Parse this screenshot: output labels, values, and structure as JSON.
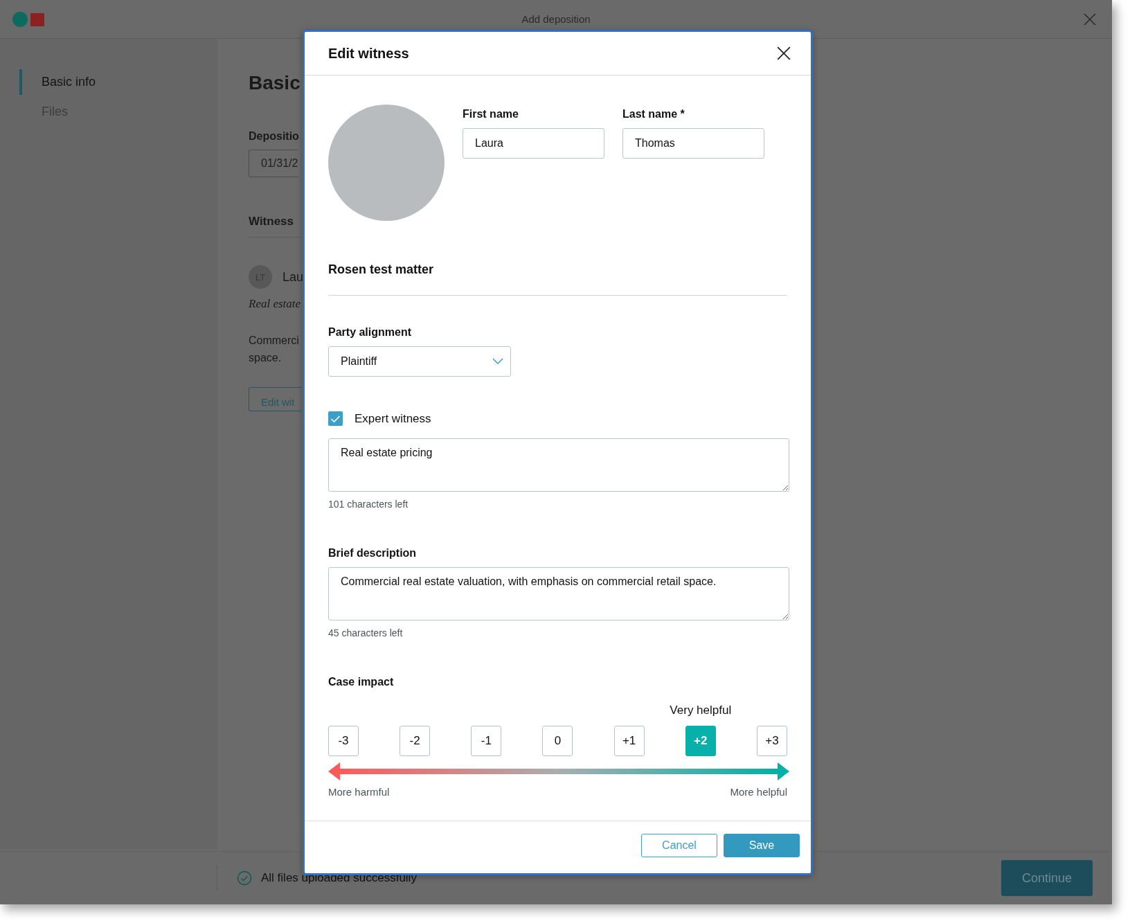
{
  "window": {
    "title": "Add deposition"
  },
  "sidebar": {
    "items": [
      {
        "label": "Basic info",
        "selected": true
      },
      {
        "label": "Files",
        "selected": false
      }
    ]
  },
  "background": {
    "heading": "Basic",
    "date_label": "Depositio",
    "date_value": "01/31/2",
    "witness_heading": "Witness",
    "witness_initials": "LT",
    "witness_name": "Lau",
    "witness_expertise": "Real estate",
    "witness_description": [
      "Commerci",
      "space."
    ],
    "edit_button": "Edit wit"
  },
  "footer": {
    "status": "All files uploaded successfully",
    "continue_button": "Continue"
  },
  "modal": {
    "title": "Edit witness",
    "first_name": {
      "label": "First name",
      "value": "Laura"
    },
    "last_name": {
      "label": "Last name *",
      "value": "Thomas"
    },
    "matter": "Rosen test matter",
    "party_alignment": {
      "label": "Party alignment",
      "value": "Plaintiff"
    },
    "expert_witness": {
      "label": "Expert witness",
      "checked": true,
      "value": "Real estate pricing",
      "counter": "101 characters left"
    },
    "brief_description": {
      "label": "Brief description",
      "value": "Commercial real estate valuation, with emphasis on commercial retail space.",
      "counter": "45 characters left"
    },
    "case_impact": {
      "label": "Case impact",
      "options": [
        {
          "label": "-3",
          "selected": false
        },
        {
          "label": "-2",
          "selected": false
        },
        {
          "label": "-1",
          "selected": false
        },
        {
          "label": "0",
          "selected": false
        },
        {
          "label": "+1",
          "selected": false
        },
        {
          "label": "+2",
          "selected": true,
          "caption": "Very helpful"
        },
        {
          "label": "+3",
          "selected": false
        }
      ],
      "min_label": "More harmful",
      "max_label": "More helpful"
    },
    "buttons": {
      "cancel": "Cancel",
      "save": "Save"
    }
  }
}
